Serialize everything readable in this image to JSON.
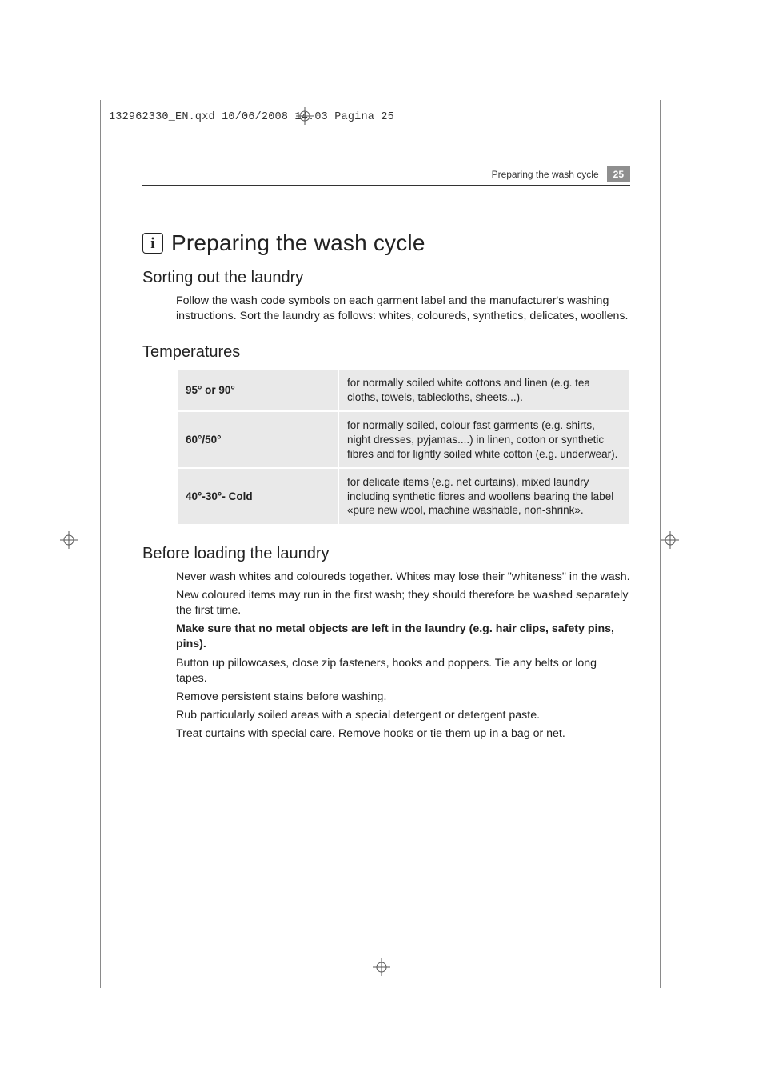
{
  "print_header": "132962330_EN.qxd  10/06/2008  14.03  Pagina 25",
  "running_head": {
    "title": "Preparing the wash cycle",
    "page": "25"
  },
  "h1": "Preparing the wash cycle",
  "info_glyph": "i",
  "sections": {
    "sorting": {
      "title": "Sorting out the laundry",
      "body": "Follow the wash code symbols on each garment label and the manufacturer's washing instructions. Sort the laundry as follows: whites, coloureds, synthetics, delicates, woollens."
    },
    "temps": {
      "title": "Temperatures",
      "rows": [
        {
          "label": "95° or 90°",
          "desc": "for normally soiled white cottons and linen (e.g. tea cloths, towels, tablecloths, sheets...)."
        },
        {
          "label": "60°/50°",
          "desc": "for normally soiled, colour fast garments (e.g. shirts, night dresses, pyjamas....) in linen, cotton or synthetic fibres and for lightly soiled white cotton (e.g. underwear)."
        },
        {
          "label": "40°-30°- Cold",
          "desc": "for delicate items (e.g. net curtains), mixed laundry including synthetic fibres and woollens bearing the label «pure new wool, machine washable, non-shrink»."
        }
      ]
    },
    "before": {
      "title": "Before loading the laundry",
      "paras": [
        "Never wash whites and coloureds together. Whites may lose their \"whiteness\" in the wash.",
        "New coloured items may run in the first wash; they should therefore be washed separately the first time.",
        "Make sure that no metal objects are left in the laundry (e.g. hair clips, safety pins, pins).",
        "Button up pillowcases, close zip fasteners, hooks and poppers. Tie any belts or long tapes.",
        "Remove persistent stains before washing.",
        "Rub particularly soiled areas with a special detergent or detergent paste.",
        "Treat curtains with special care. Remove hooks or tie them up in a bag or net."
      ],
      "bold_index": 2
    }
  }
}
